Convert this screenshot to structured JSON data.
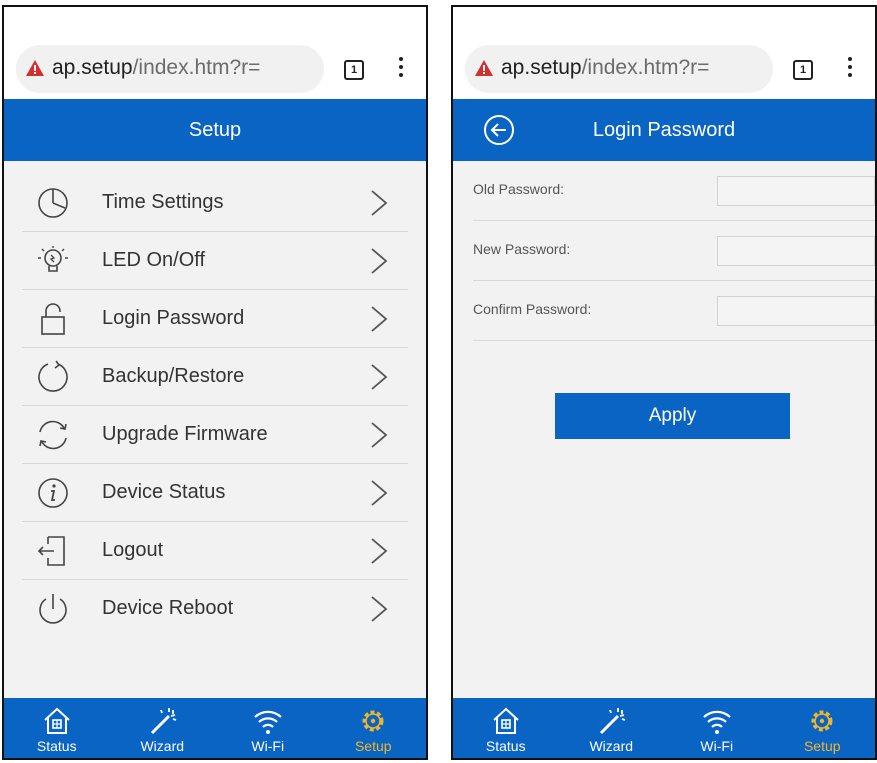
{
  "browser": {
    "url_host": "ap.setup",
    "url_path": "/index.htm?r=",
    "tab_count": "1"
  },
  "setup_screen": {
    "title": "Setup",
    "items": [
      {
        "label": "Time Settings",
        "icon": "clock-icon"
      },
      {
        "label": "LED On/Off",
        "icon": "lightbulb-icon"
      },
      {
        "label": "Login Password",
        "icon": "lock-icon"
      },
      {
        "label": "Backup/Restore",
        "icon": "restore-icon"
      },
      {
        "label": "Upgrade Firmware",
        "icon": "refresh-icon"
      },
      {
        "label": "Device Status",
        "icon": "info-icon"
      },
      {
        "label": "Logout",
        "icon": "logout-icon"
      },
      {
        "label": "Device Reboot",
        "icon": "power-icon"
      }
    ]
  },
  "password_screen": {
    "title": "Login Password",
    "fields": [
      {
        "label": "Old Password:",
        "value": ""
      },
      {
        "label": "New Password:",
        "value": ""
      },
      {
        "label": "Confirm Password:",
        "value": ""
      }
    ],
    "apply_label": "Apply"
  },
  "tabbar": {
    "tabs": [
      {
        "label": "Status",
        "icon": "home-icon"
      },
      {
        "label": "Wizard",
        "icon": "magic-wand-icon"
      },
      {
        "label": "Wi-Fi",
        "icon": "wifi-icon"
      },
      {
        "label": "Setup",
        "icon": "gear-icon"
      }
    ],
    "active_tab": "Setup"
  },
  "colors": {
    "accent": "#0a64c4",
    "active_tab": "#f2b52a",
    "warning": "#d32f2f"
  }
}
